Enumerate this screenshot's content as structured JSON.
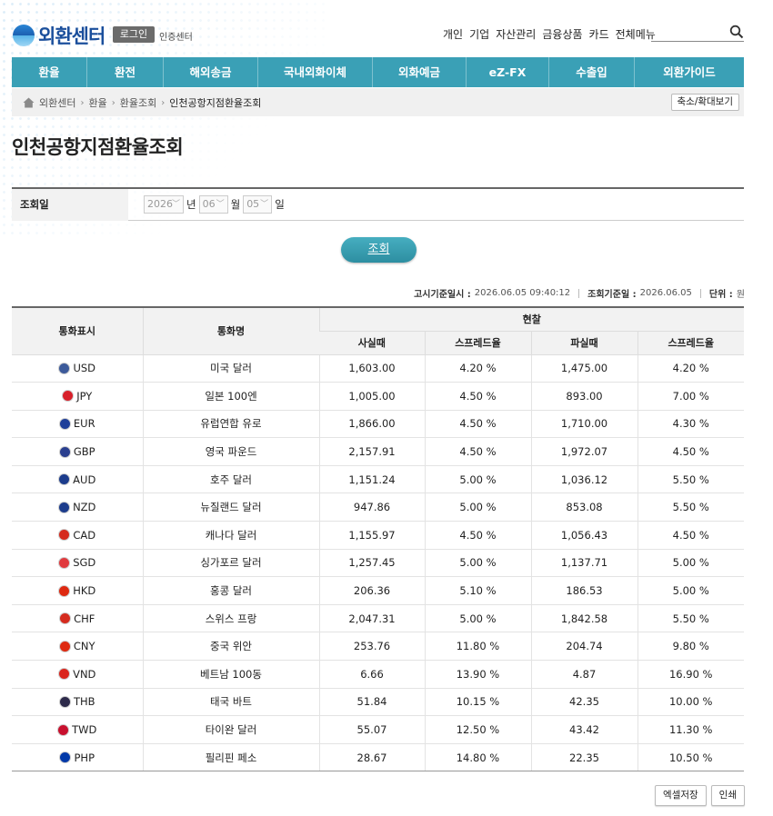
{
  "header": {
    "logo_text": "외환센터",
    "login_label": "로그인",
    "cert_label": "인증센터",
    "top_menu": [
      "개인",
      "기업",
      "자산관리",
      "금융상품",
      "카드",
      "전체메뉴"
    ]
  },
  "nav": {
    "items": [
      "환율",
      "환전",
      "해외송금",
      "국내외화이체",
      "외화예금",
      "eZ-FX",
      "수출입",
      "외환가이드"
    ]
  },
  "breadcrumb": {
    "items": [
      "외환센터",
      "환율",
      "환율조회"
    ],
    "current": "인천공항지점환율조회",
    "zoom_label": "축소/확대보기"
  },
  "page_title": "인천공항지점환율조회",
  "search_form": {
    "label": "조회일",
    "year": "2026",
    "year_unit": "년",
    "month": "06",
    "month_unit": "월",
    "day": "05",
    "day_unit": "일",
    "button": "조회"
  },
  "info": {
    "notice_label": "고시기준일시 :",
    "notice_value": "2026.06.05 09:40:12",
    "query_label": "조회기준일 :",
    "query_value": "2026.06.05",
    "unit_label": "단위 :",
    "unit_value": "원"
  },
  "table": {
    "headers": {
      "currency_code": "통화표시",
      "currency_name": "통화명",
      "cash": "현찰",
      "buy": "사실때",
      "buy_spread": "스프레드율",
      "sell": "파실때",
      "sell_spread": "스프레드율"
    },
    "rows": [
      {
        "code": "USD",
        "name": "미국 달러",
        "buy": "1,603.00",
        "buy_spread": "4.20 %",
        "sell": "1,475.00",
        "sell_spread": "4.20 %",
        "flag_color": "#3c5a9a"
      },
      {
        "code": "JPY",
        "name": "일본 100엔",
        "buy": "1,005.00",
        "buy_spread": "4.50 %",
        "sell": "893.00",
        "sell_spread": "7.00 %",
        "flag_color": "#d8202a"
      },
      {
        "code": "EUR",
        "name": "유럽연합 유로",
        "buy": "1,866.00",
        "buy_spread": "4.50 %",
        "sell": "1,710.00",
        "sell_spread": "4.30 %",
        "flag_color": "#1f3f99"
      },
      {
        "code": "GBP",
        "name": "영국 파운드",
        "buy": "2,157.91",
        "buy_spread": "4.50 %",
        "sell": "1,972.07",
        "sell_spread": "4.50 %",
        "flag_color": "#2a3f8f"
      },
      {
        "code": "AUD",
        "name": "호주 달러",
        "buy": "1,151.24",
        "buy_spread": "5.00 %",
        "sell": "1,036.12",
        "sell_spread": "5.50 %",
        "flag_color": "#1c3c8c"
      },
      {
        "code": "NZD",
        "name": "뉴질랜드 달러",
        "buy": "947.86",
        "buy_spread": "5.00 %",
        "sell": "853.08",
        "sell_spread": "5.50 %",
        "flag_color": "#1c3c8c"
      },
      {
        "code": "CAD",
        "name": "캐나다 달러",
        "buy": "1,155.97",
        "buy_spread": "4.50 %",
        "sell": "1,056.43",
        "sell_spread": "4.50 %",
        "flag_color": "#d52b1e"
      },
      {
        "code": "SGD",
        "name": "싱가포르 달러",
        "buy": "1,257.45",
        "buy_spread": "5.00 %",
        "sell": "1,137.71",
        "sell_spread": "5.00 %",
        "flag_color": "#e03a3e"
      },
      {
        "code": "HKD",
        "name": "홍콩 달러",
        "buy": "206.36",
        "buy_spread": "5.10 %",
        "sell": "186.53",
        "sell_spread": "5.00 %",
        "flag_color": "#de2910"
      },
      {
        "code": "CHF",
        "name": "스위스 프랑",
        "buy": "2,047.31",
        "buy_spread": "5.00 %",
        "sell": "1,842.58",
        "sell_spread": "5.50 %",
        "flag_color": "#d52b1e"
      },
      {
        "code": "CNY",
        "name": "중국 위안",
        "buy": "253.76",
        "buy_spread": "11.80 %",
        "sell": "204.74",
        "sell_spread": "9.80 %",
        "flag_color": "#de2910"
      },
      {
        "code": "VND",
        "name": "베트남 100동",
        "buy": "6.66",
        "buy_spread": "13.90 %",
        "sell": "4.87",
        "sell_spread": "16.90 %",
        "flag_color": "#da251d"
      },
      {
        "code": "THB",
        "name": "태국 바트",
        "buy": "51.84",
        "buy_spread": "10.15 %",
        "sell": "42.35",
        "sell_spread": "10.00 %",
        "flag_color": "#2d2a4a"
      },
      {
        "code": "TWD",
        "name": "타이완 달러",
        "buy": "55.07",
        "buy_spread": "12.50 %",
        "sell": "43.42",
        "sell_spread": "11.30 %",
        "flag_color": "#c8102e"
      },
      {
        "code": "PHP",
        "name": "필리핀 페소",
        "buy": "28.67",
        "buy_spread": "14.80 %",
        "sell": "22.35",
        "sell_spread": "10.50 %",
        "flag_color": "#0038a8"
      }
    ]
  },
  "bottom": {
    "excel_label": "엑셀저장",
    "print_label": "인쇄"
  },
  "colors": {
    "nav_bg": "#3aa0b6",
    "logo": "#1b4f9c",
    "button": "#2d8ea1"
  }
}
